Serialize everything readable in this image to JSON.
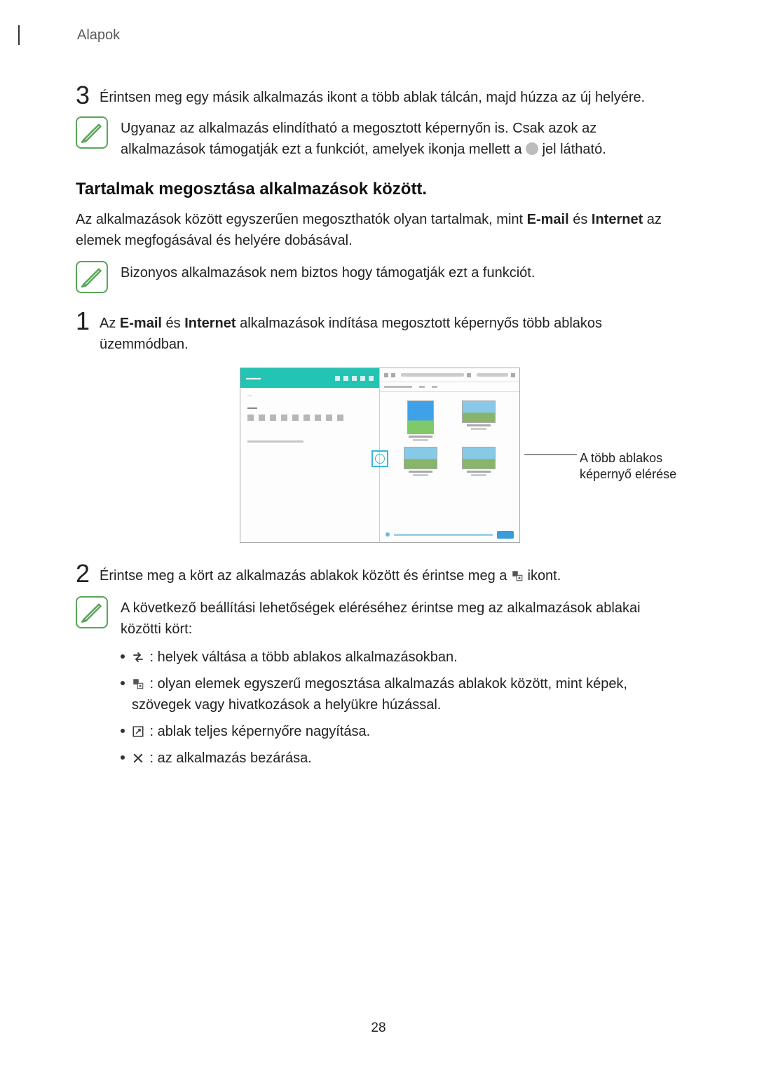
{
  "header": {
    "section": "Alapok"
  },
  "step3": {
    "num": "3",
    "text": "Érintsen meg egy másik alkalmazás ikont a több ablak tálcán, majd húzza az új helyére."
  },
  "note1": {
    "part1": "Ugyanaz az alkalmazás elindítható a megosztott képernyőn is. Csak azok az alkalmazások támogatják ezt a funkciót, amelyek ikonja mellett a ",
    "part2": " jel látható."
  },
  "heading": "Tartalmak megosztása alkalmazások között.",
  "intro": {
    "part1": "Az alkalmazások között egyszerűen megoszthatók olyan tartalmak, mint ",
    "bold1": "E-mail",
    "mid": " és ",
    "bold2": "Internet",
    "part2": " az elemek megfogásával és helyére dobásával."
  },
  "note2": {
    "text": "Bizonyos alkalmazások nem biztos hogy támogatják ezt a funkciót."
  },
  "step1": {
    "num": "1",
    "part1": "Az ",
    "bold1": "E-mail",
    "mid": " és ",
    "bold2": "Internet",
    "part2": " alkalmazások indítása megosztott képernyős több ablakos üzemmódban."
  },
  "callout": {
    "line1": "A több ablakos",
    "line2": "képernyő elérése"
  },
  "step2": {
    "num": "2",
    "part1": "Érintse meg a kört az alkalmazás ablakok között és érintse meg a ",
    "part2": " ikont."
  },
  "note3": {
    "intro": "A következő beállítási lehetőségek eléréséhez érintse meg az alkalmazások ablakai közötti kört:",
    "items": [
      " : helyek váltása a több ablakos alkalmazásokban.",
      " : olyan elemek egyszerű megosztása alkalmazás ablakok között, mint képek, szövegek vagy hivatkozások a helyükre húzással.",
      " : ablak teljes képernyőre nagyítása.",
      " : az alkalmazás bezárása."
    ]
  },
  "page_number": "28"
}
